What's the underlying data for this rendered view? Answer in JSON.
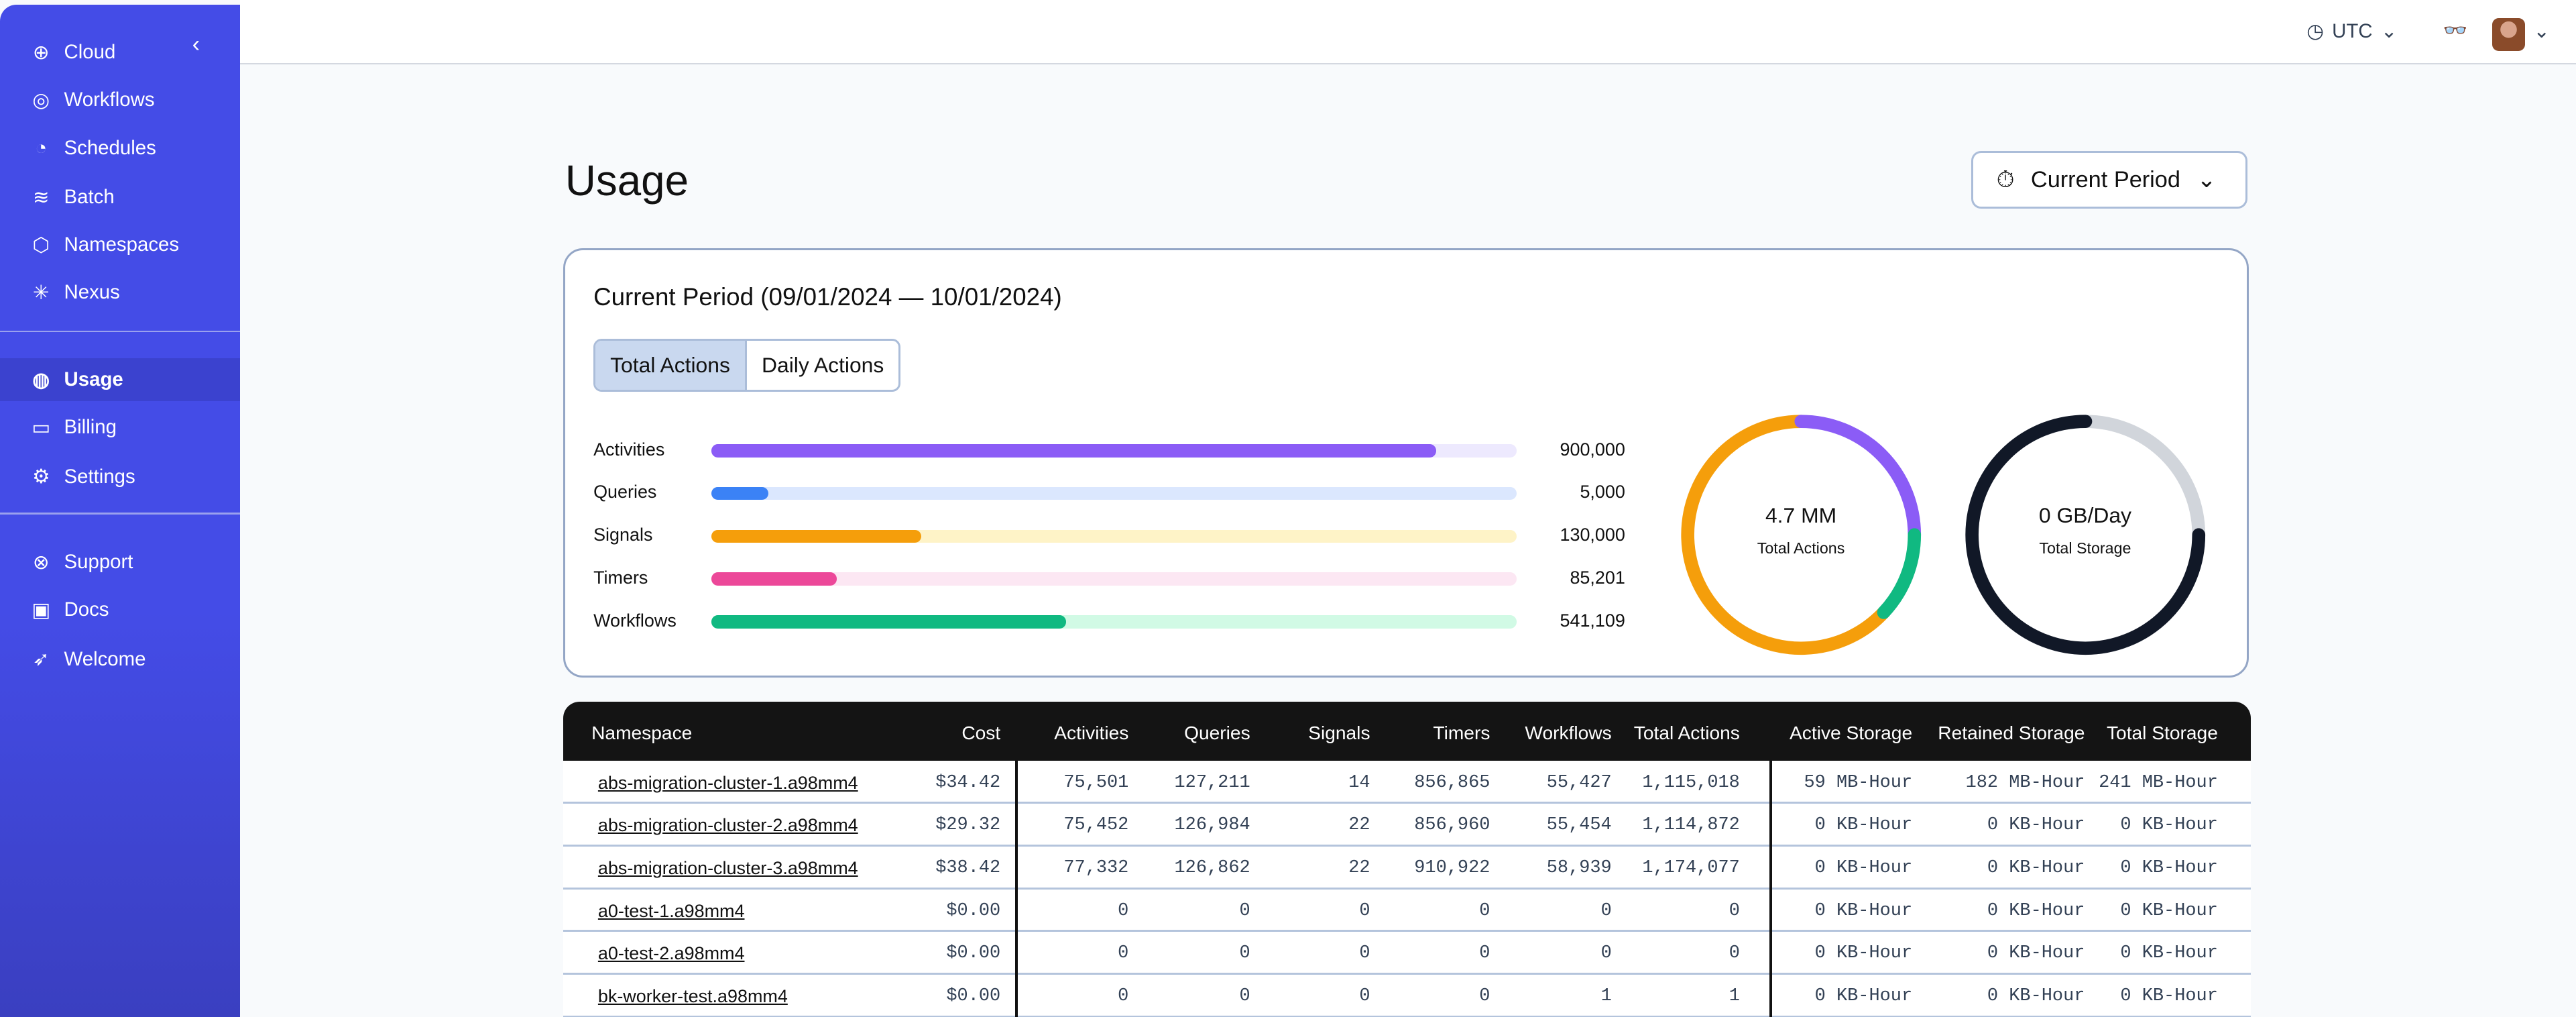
{
  "sidebar": {
    "brand": "Cloud",
    "items": [
      {
        "label": "Workflows",
        "icon": "workflows-icon"
      },
      {
        "label": "Schedules",
        "icon": "schedules-icon"
      },
      {
        "label": "Batch",
        "icon": "layers-icon"
      },
      {
        "label": "Namespaces",
        "icon": "cube-icon"
      },
      {
        "label": "Nexus",
        "icon": "asterisk-icon"
      },
      {
        "label": "Usage",
        "icon": "gauge-icon",
        "active": true
      },
      {
        "label": "Billing",
        "icon": "credit-card-icon"
      },
      {
        "label": "Settings",
        "icon": "gear-icon"
      },
      {
        "label": "Support",
        "icon": "lifebuoy-icon"
      },
      {
        "label": "Docs",
        "icon": "book-icon"
      },
      {
        "label": "Welcome",
        "icon": "rocket-icon"
      }
    ]
  },
  "header": {
    "timezone": "UTC"
  },
  "page": {
    "title": "Usage",
    "period_button": "Current Period"
  },
  "card": {
    "title": "Current Period (09/01/2024 — 10/01/2024)",
    "tabs": [
      "Total Actions",
      "Daily Actions"
    ],
    "active_tab": "Total Actions",
    "bars": [
      {
        "label": "Activities",
        "value": "900,000",
        "fill": 0.9,
        "color": "#8b5cf6",
        "track": "#ede9fe"
      },
      {
        "label": "Queries",
        "value": "5,000",
        "fill": 0.07,
        "color": "#3b82f6",
        "track": "#dbe7fe"
      },
      {
        "label": "Signals",
        "value": "130,000",
        "fill": 0.26,
        "color": "#f59e0b",
        "track": "#fef3c7"
      },
      {
        "label": "Timers",
        "value": "85,201",
        "fill": 0.155,
        "color": "#ec4899",
        "track": "#fce7f3"
      },
      {
        "label": "Workflows",
        "value": "541,109",
        "fill": 0.44,
        "color": "#10b981",
        "track": "#d1fae5"
      }
    ],
    "actions_donut": {
      "value": "4.7 MM",
      "label": "Total Actions",
      "segments": [
        {
          "color": "#8b5cf6",
          "fraction": 0.25
        },
        {
          "color": "#10b981",
          "fraction": 0.12
        },
        {
          "color": "#f59e0b",
          "fraction": 0.63
        }
      ]
    },
    "storage_donut": {
      "value": "0 GB/Day",
      "label": "Total Storage",
      "fill": 0.75,
      "color": "#111827",
      "track": "#d1d5db"
    }
  },
  "table": {
    "columns": [
      "Namespace",
      "Cost",
      "Activities",
      "Queries",
      "Signals",
      "Timers",
      "Workflows",
      "Total Actions",
      "Active Storage",
      "Retained Storage",
      "Total Storage"
    ],
    "rows": [
      [
        "abs-migration-cluster-1.a98mm4",
        "$34.42",
        "75,501",
        "127,211",
        "14",
        "856,865",
        "55,427",
        "1,115,018",
        "59 MB-Hour",
        "182 MB-Hour",
        "241 MB-Hour"
      ],
      [
        "abs-migration-cluster-2.a98mm4",
        "$29.32",
        "75,452",
        "126,984",
        "22",
        "856,960",
        "55,454",
        "1,114,872",
        "0 KB-Hour",
        "0 KB-Hour",
        "0 KB-Hour"
      ],
      [
        "abs-migration-cluster-3.a98mm4",
        "$38.42",
        "77,332",
        "126,862",
        "22",
        "910,922",
        "58,939",
        "1,174,077",
        "0 KB-Hour",
        "0 KB-Hour",
        "0 KB-Hour"
      ],
      [
        "a0-test-1.a98mm4",
        "$0.00",
        "0",
        "0",
        "0",
        "0",
        "0",
        "0",
        "0 KB-Hour",
        "0 KB-Hour",
        "0 KB-Hour"
      ],
      [
        "a0-test-2.a98mm4",
        "$0.00",
        "0",
        "0",
        "0",
        "0",
        "0",
        "0",
        "0 KB-Hour",
        "0 KB-Hour",
        "0 KB-Hour"
      ],
      [
        "bk-worker-test.a98mm4",
        "$0.00",
        "0",
        "0",
        "0",
        "0",
        "1",
        "1",
        "0 KB-Hour",
        "0 KB-Hour",
        "0 KB-Hour"
      ]
    ]
  }
}
